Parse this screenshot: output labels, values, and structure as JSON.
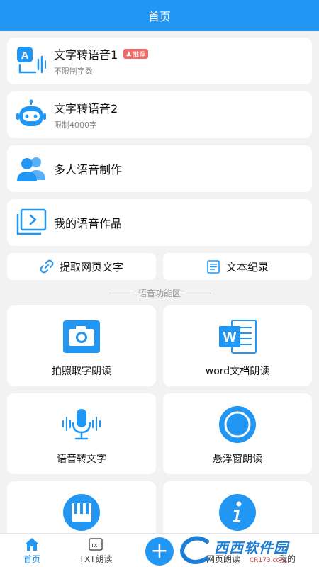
{
  "header": {
    "title": "首页"
  },
  "cards": [
    {
      "title": "文字转语音1",
      "sub": "不限制字数",
      "badge": "推荐",
      "badge_icon": "thumbs-up-icon",
      "icon": "text-to-speech-icon"
    },
    {
      "title": "文字转语音2",
      "sub": "限制4000字",
      "icon": "robot-icon"
    },
    {
      "title": "多人语音制作",
      "icon": "people-icon"
    },
    {
      "title": "我的语音作品",
      "icon": "folder-play-icon"
    }
  ],
  "quick": [
    {
      "label": "提取网页文字",
      "icon": "link-icon"
    },
    {
      "label": "文本纪录",
      "icon": "notepad-icon"
    }
  ],
  "section": {
    "title": "语音功能区"
  },
  "tiles": [
    {
      "label": "拍照取字朗读",
      "icon": "camera-icon"
    },
    {
      "label": "word文档朗读",
      "icon": "word-icon"
    },
    {
      "label": "语音转文字",
      "icon": "microphone-icon"
    },
    {
      "label": "悬浮窗朗读",
      "icon": "floating-circle-icon"
    },
    {
      "label": "",
      "icon": "piano-icon"
    },
    {
      "label": "",
      "icon": "info-icon"
    }
  ],
  "tabs": [
    {
      "label": "首页",
      "icon": "home-icon"
    },
    {
      "label": "TXT朗读",
      "icon": "txt-icon"
    },
    {
      "label": "",
      "icon": "plus-icon"
    },
    {
      "label": "网页朗读",
      "icon": "globe-icon"
    },
    {
      "label": "我的",
      "icon": "user-icon"
    }
  ],
  "watermark": {
    "title": "西西软件园",
    "url": "CR173.com"
  },
  "colors": {
    "primary": "#2196f3",
    "badge": "#f06a6a",
    "background": "#f2f2f2"
  }
}
